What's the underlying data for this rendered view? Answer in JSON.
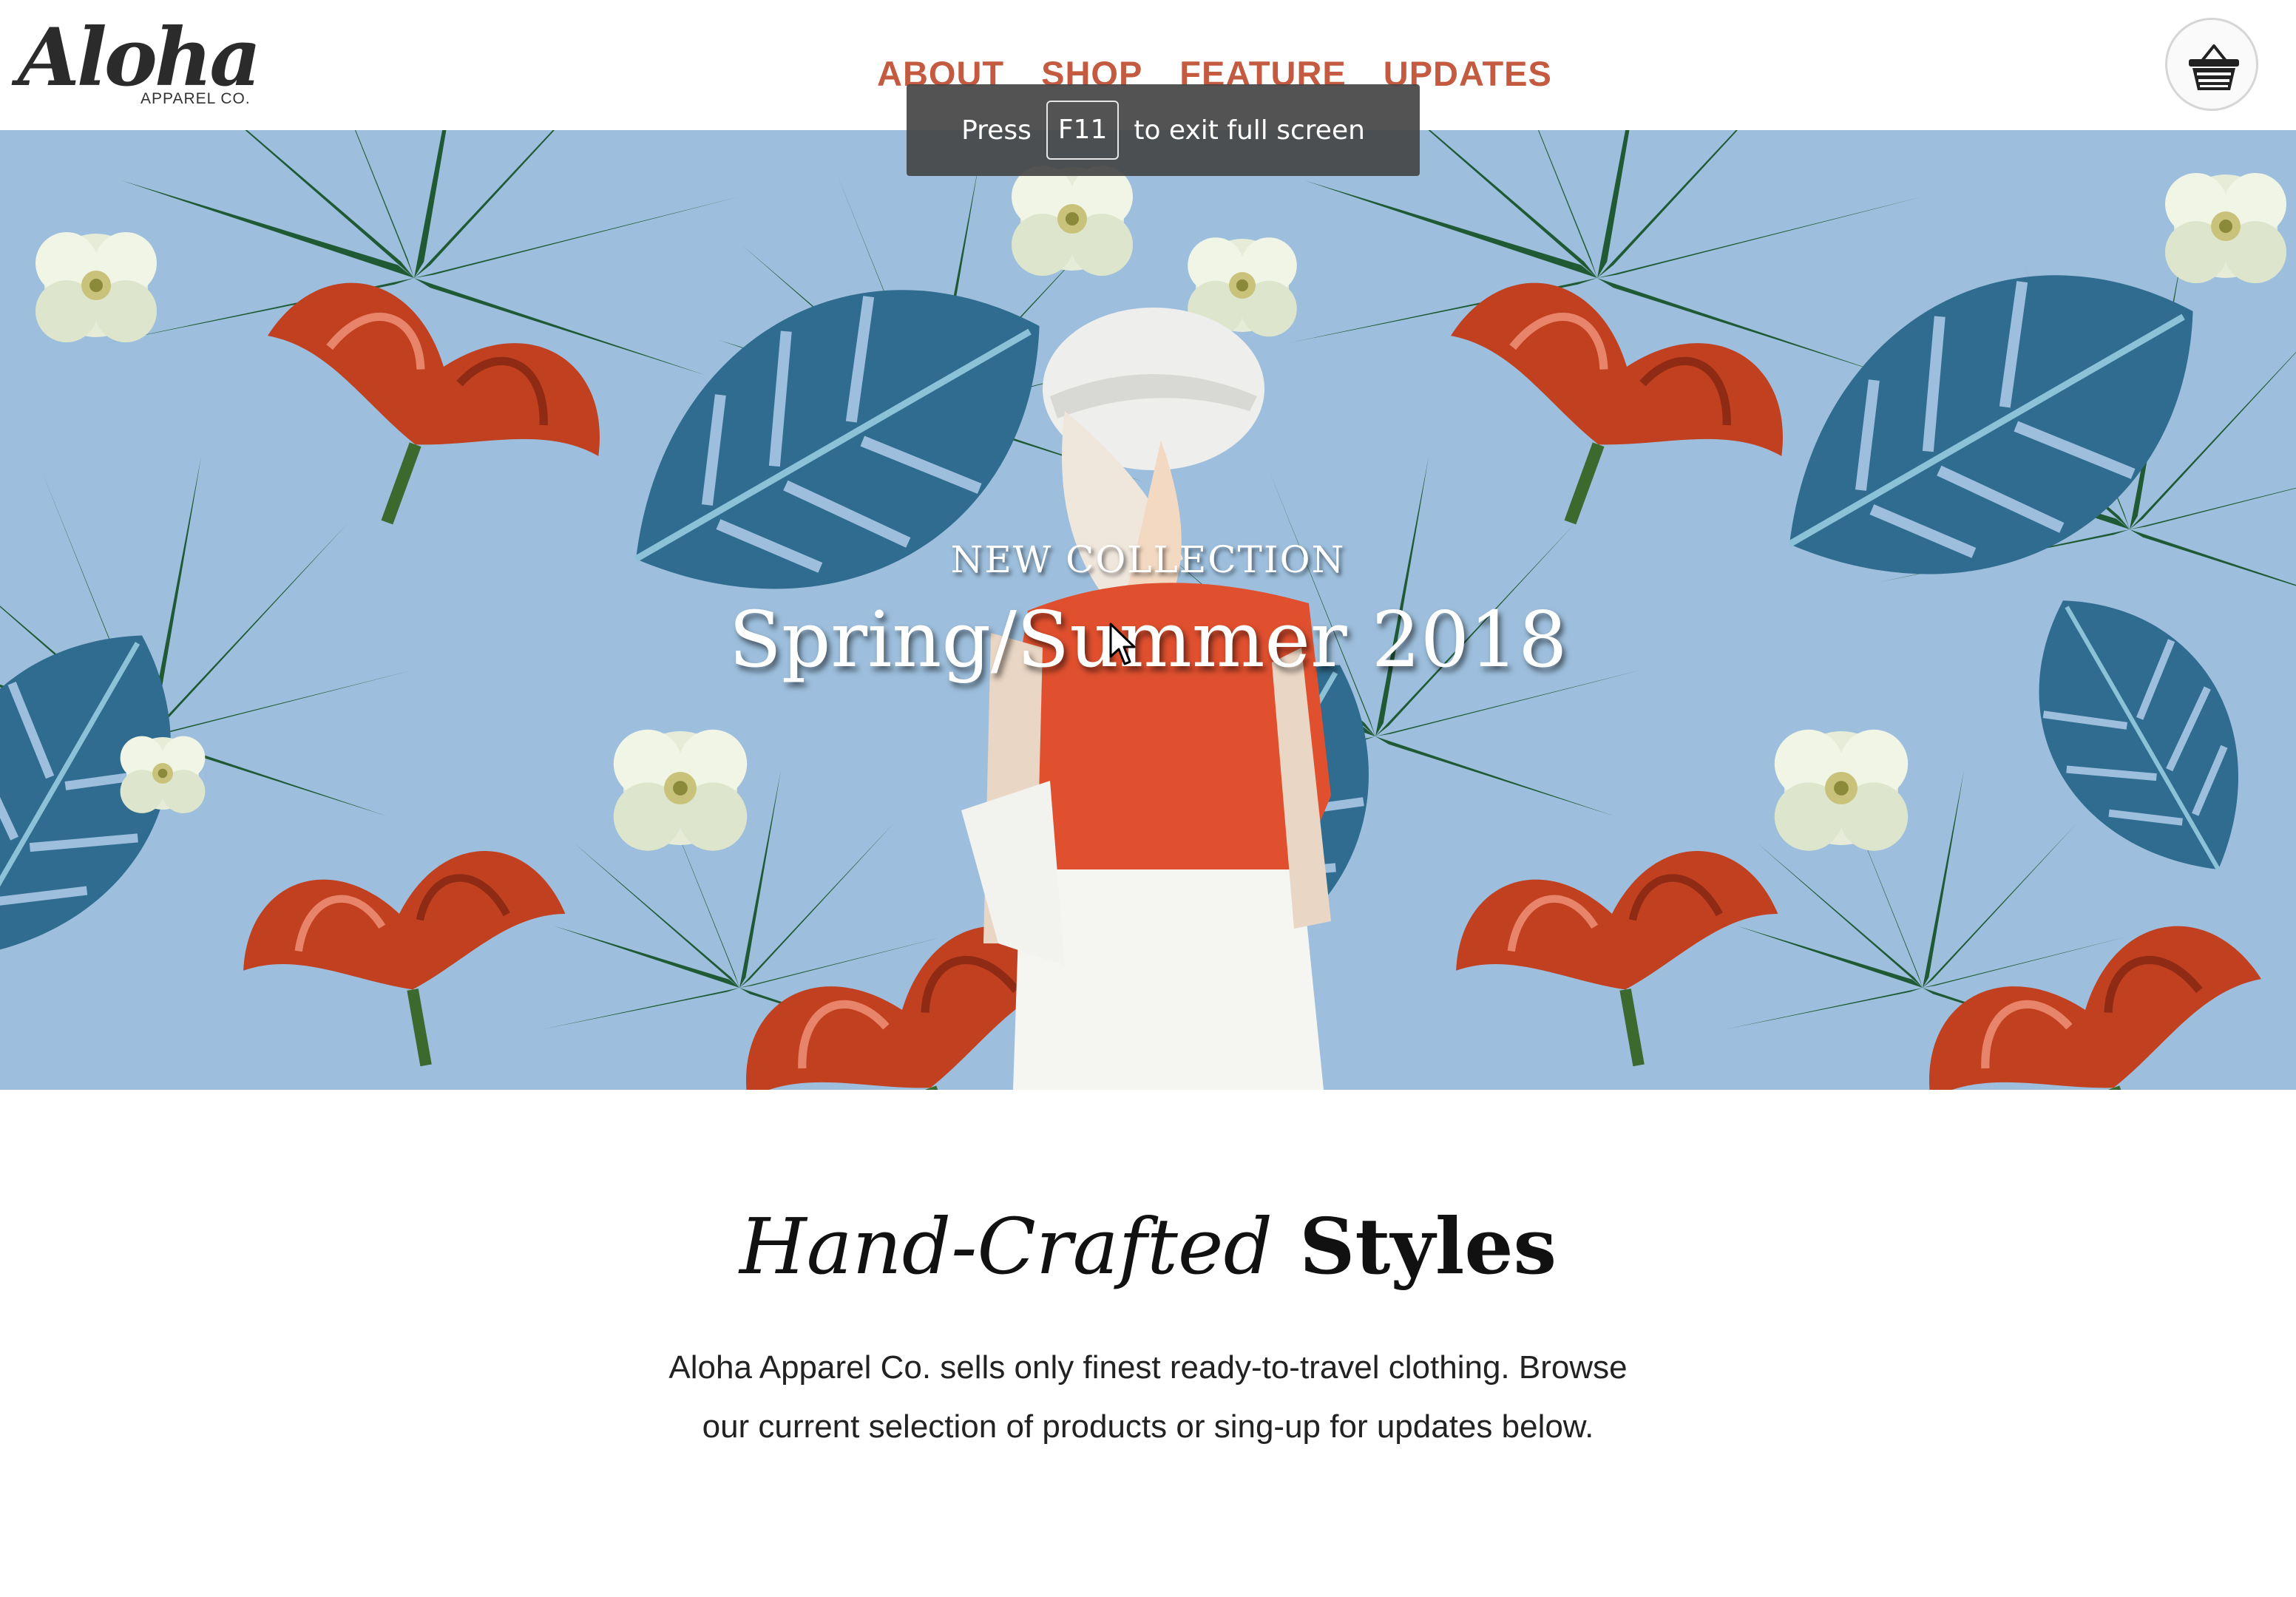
{
  "header": {
    "logo_script": "Aloha",
    "logo_subtitle": "APPAREL CO.",
    "nav": [
      {
        "label": "ABOUT"
      },
      {
        "label": "SHOP"
      },
      {
        "label": "FEATURE"
      },
      {
        "label": "UPDATES"
      }
    ],
    "cart_icon": "basket-icon"
  },
  "fullscreen_toast": {
    "press": "Press",
    "key": "F11",
    "rest": "to exit full screen"
  },
  "hero": {
    "eyebrow": "NEW COLLECTION",
    "title": "Spring/Summer 2018"
  },
  "intro": {
    "heading_italic": "Hand-Crafted",
    "heading_bold": "Styles",
    "body": "Aloha Apparel Co. sells only finest ready-to-travel clothing. Browse our current selection of products or sing-up for updates below."
  },
  "colors": {
    "accent": "#c45a3f",
    "hero_bg": "#9dbfdd",
    "toast_bg": "#464646"
  }
}
